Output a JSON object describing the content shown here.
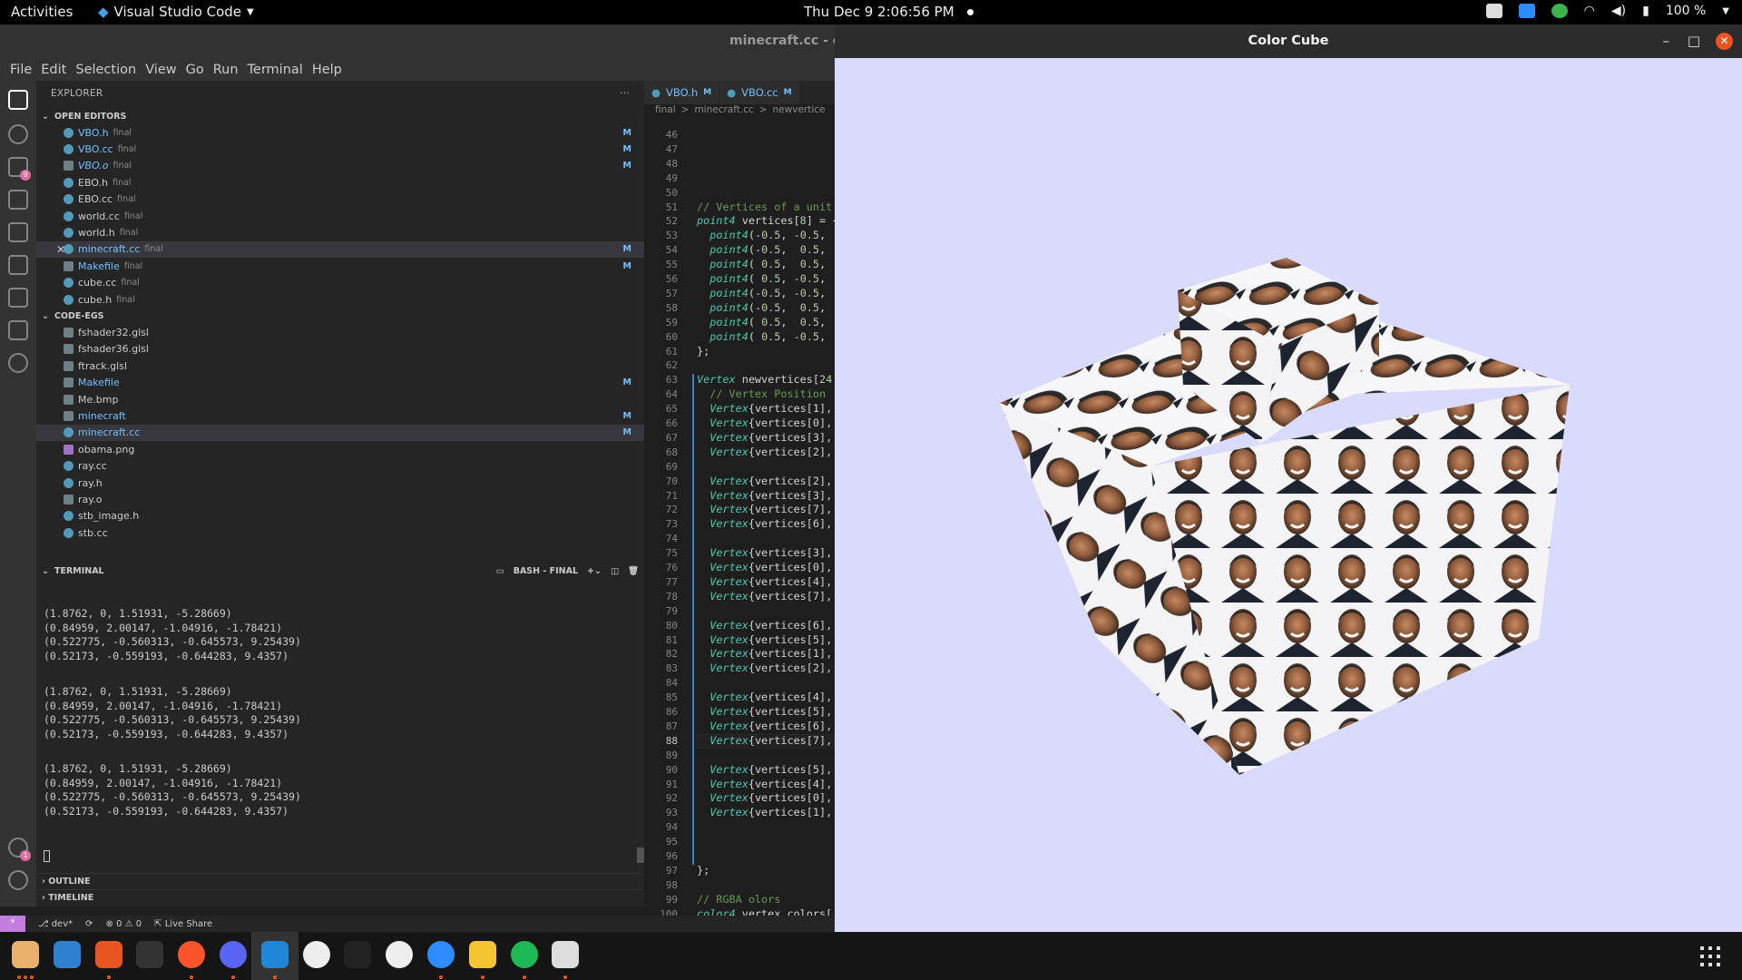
{
  "topbar": {
    "activities": "Activities",
    "app": "Visual Studio Code",
    "datetime": "Thu Dec 9  2:06:56 PM",
    "battery": "100 %"
  },
  "vscode": {
    "title": "minecraft.cc - co",
    "menu": [
      "File",
      "Edit",
      "Selection",
      "View",
      "Go",
      "Run",
      "Terminal",
      "Help"
    ],
    "explorer_label": "EXPLORER",
    "open_editors_label": "OPEN EDITORS",
    "open_editors": [
      {
        "name": "VBO.h",
        "dir": "final",
        "modified": "M",
        "style": "mod"
      },
      {
        "name": "VBO.cc",
        "dir": "final",
        "modified": "M",
        "style": "mod"
      },
      {
        "name": "VBO.o",
        "dir": "final",
        "modified": "M",
        "style": "ital"
      },
      {
        "name": "EBO.h",
        "dir": "final",
        "modified": "",
        "style": ""
      },
      {
        "name": "EBO.cc",
        "dir": "final",
        "modified": "",
        "style": ""
      },
      {
        "name": "world.cc",
        "dir": "final",
        "modified": "",
        "style": ""
      },
      {
        "name": "world.h",
        "dir": "final",
        "modified": "",
        "style": ""
      },
      {
        "name": "minecraft.cc",
        "dir": "final",
        "modified": "M",
        "style": "mod"
      },
      {
        "name": "Makefile",
        "dir": "final",
        "modified": "M",
        "style": "mod"
      },
      {
        "name": "cube.cc",
        "dir": "final",
        "modified": "",
        "style": ""
      },
      {
        "name": "cube.h",
        "dir": "final",
        "modified": "",
        "style": ""
      }
    ],
    "folder_label": "CODE-EGS",
    "folder_files": [
      {
        "name": "fshader32.glsl",
        "modified": "",
        "style": ""
      },
      {
        "name": "fshader36.glsl",
        "modified": "",
        "style": ""
      },
      {
        "name": "ftrack.glsl",
        "modified": "",
        "style": ""
      },
      {
        "name": "Makefile",
        "modified": "M",
        "style": "mod"
      },
      {
        "name": "Me.bmp",
        "modified": "",
        "style": ""
      },
      {
        "name": "minecraft",
        "modified": "M",
        "style": "mod"
      },
      {
        "name": "minecraft.cc",
        "modified": "M",
        "style": "mod"
      },
      {
        "name": "obama.png",
        "modified": "",
        "style": ""
      },
      {
        "name": "ray.cc",
        "modified": "",
        "style": ""
      },
      {
        "name": "ray.h",
        "modified": "",
        "style": ""
      },
      {
        "name": "ray.o",
        "modified": "",
        "style": ""
      },
      {
        "name": "stb_image.h",
        "modified": "",
        "style": ""
      },
      {
        "name": "stb.cc",
        "modified": "",
        "style": ""
      }
    ],
    "terminal_label": "TERMINAL",
    "terminal_shell": "BASH - FINAL",
    "terminal_output": "(1.8762, 0, 1.51931, -5.28669)\n(0.84959, 2.00147, -1.04916, -1.78421)\n(0.522775, -0.560313, -0.645573, 9.25439)\n(0.52173, -0.559193, -0.644283, 9.4357)",
    "outline_label": "OUTLINE",
    "timeline_label": "TIMELINE",
    "tabs": [
      {
        "name": "VBO.h",
        "flag": "M"
      },
      {
        "name": "VBO.cc",
        "flag": "M"
      }
    ],
    "breadcrumb": [
      "final",
      ">",
      "minecraft.cc",
      ">",
      "newvertice"
    ],
    "status": {
      "branch": "dev*",
      "problems": "0",
      "warnings": "0",
      "liveshare": "Live Share"
    }
  },
  "cube_window": {
    "title": "Color Cube",
    "bg_color": "#dadbfc"
  },
  "dock": {
    "apps": [
      "files-icon",
      "writer-icon",
      "software-icon",
      "terminal-icon",
      "brave-icon",
      "discord-icon",
      "vscode-icon",
      "obs-icon",
      "monitor-icon",
      "github-icon",
      "zoom-icon",
      "calculator-icon",
      "spotify-icon",
      "editor-icon"
    ]
  }
}
